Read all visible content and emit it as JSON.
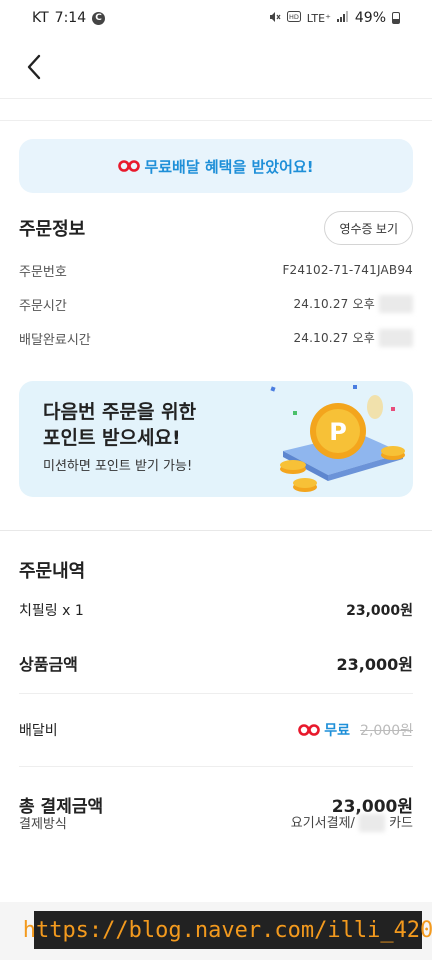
{
  "status": {
    "carrier": "KT",
    "time": "7:14",
    "c_icon": "C",
    "network": "LTE⁺",
    "battery": "49%"
  },
  "benefit": {
    "text": "무료배달 혜택을 받았어요!"
  },
  "order_info": {
    "title": "주문정보",
    "receipt_button": "영수증 보기",
    "rows": [
      {
        "label": "주문번호",
        "value": "F24102-71-741JAB94"
      },
      {
        "label": "주문시간",
        "value": "24.10.27 오후"
      },
      {
        "label": "배달완료시간",
        "value": "24.10.27 오후"
      }
    ]
  },
  "point_banner": {
    "title_line1": "다음번 주문을 위한",
    "title_line2": "포인트 받으세요!",
    "subtitle": "미션하면 포인트 받기 가능!",
    "coin_letter": "P"
  },
  "order_details": {
    "title": "주문내역",
    "item_name": "치필링 x 1",
    "item_price": "23,000원",
    "subtotal_label": "상품금액",
    "subtotal_value": "23,000원",
    "delivery_label": "배달비",
    "delivery_free": "무료",
    "delivery_original": "2,000원",
    "total_label": "총 결제금액",
    "total_value": "23,000원",
    "payment_label": "결제방식",
    "payment_value_prefix": "요기서결제/",
    "payment_value_suffix": "카드"
  },
  "watermark": {
    "text": "https://blog.naver.com/illi_420"
  },
  "colors": {
    "accent": "#1e8fd8",
    "banner_bg": "#e8f4fc",
    "logo_red": "#e8192c"
  }
}
